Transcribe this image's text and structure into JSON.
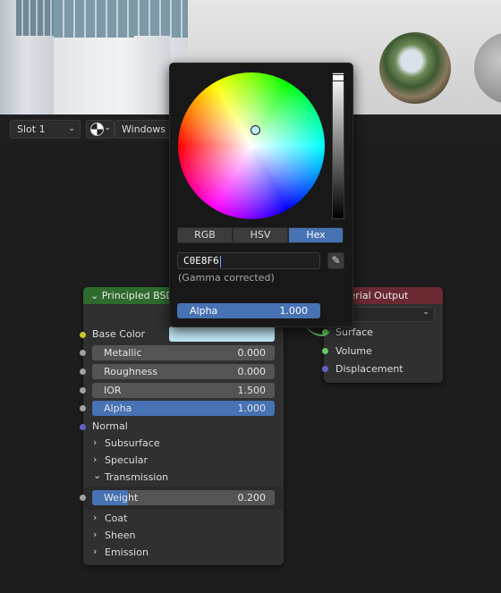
{
  "header": {
    "slot_label": "Slot 1",
    "shading_label": "Windows"
  },
  "principled_node": {
    "title": "Principled BSDF",
    "base_color_label": "Base Color",
    "base_color_value": "#c0e8f6",
    "fields": [
      {
        "label": "Metallic",
        "value": "0.000"
      },
      {
        "label": "Roughness",
        "value": "0.000"
      },
      {
        "label": "IOR",
        "value": "1.500"
      },
      {
        "label": "Alpha",
        "value": "1.000"
      }
    ],
    "normal_label": "Normal",
    "panels": [
      "Subsurface",
      "Specular",
      "Transmission"
    ],
    "weight": {
      "label": "Weight",
      "value": "0.200",
      "fill_fraction": 0.2
    },
    "panels_after": [
      "Coat",
      "Sheen",
      "Emission"
    ]
  },
  "output_node": {
    "title": "Material Output",
    "sockets": [
      "Surface",
      "Volume",
      "Displacement"
    ]
  },
  "color_picker": {
    "tabs": [
      "RGB",
      "HSV",
      "Hex"
    ],
    "active_tab": "Hex",
    "hex_value": "C0E8F6",
    "gamma_note": "(Gamma corrected)",
    "alpha_label": "Alpha",
    "alpha_value": "1.000"
  }
}
